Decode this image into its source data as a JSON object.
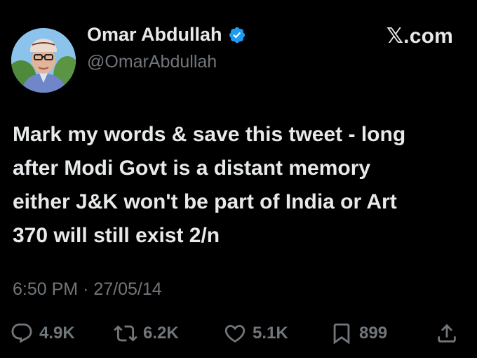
{
  "user": {
    "display_name": "Omar Abdullah",
    "handle": "@OmarAbdullah",
    "avatar_icon": "profile-photo",
    "verified_icon": "verified-badge-icon",
    "verified_color": "#1d9bf0"
  },
  "brand": {
    "label": "𝕏.com"
  },
  "tweet": {
    "text": "Mark my words & save this tweet - long\nafter Modi Govt is a distant memory\neither J&K won't be part of India or Art\n370 will still exist 2/n",
    "time": "6:50 PM",
    "separator": "·",
    "date": "27/05/14"
  },
  "actions": {
    "replies": "4.9K",
    "reposts": "6.2K",
    "likes": "5.1K",
    "bookmarks": "899"
  },
  "colors": {
    "background": "#000000",
    "text": "#e7e9ea",
    "secondary": "#71767b"
  }
}
